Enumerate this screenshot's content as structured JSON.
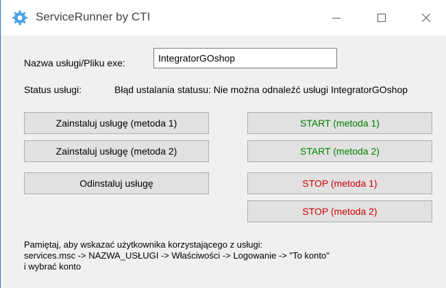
{
  "window": {
    "title": "ServiceRunner by CTI",
    "icon": "gear-icon",
    "controls": [
      "minimize-icon",
      "maximize-icon",
      "close-icon"
    ]
  },
  "service": {
    "name_label": "Nazwa usługi/Pliku exe:",
    "name_value": "IntegratorGOshop",
    "status_label": "Status usługi:",
    "status_value": "Błąd ustalania statusu: Nie można odnaleźć usługi IntegratorGOshop"
  },
  "buttons": {
    "install1": "Zainstaluj usługę (metoda 1)",
    "install2": "Zainstaluj usługę (metoda 2)",
    "uninstall": "Odinstaluj usługę",
    "start1": "START (metoda 1)",
    "start2": "START (metoda 2)",
    "stop1": "STOP (metoda 1)",
    "stop2": "STOP (metoda 2)"
  },
  "note": {
    "line1": "Pamiętaj, aby wskazać użytkownika korzystającego z usługi:",
    "line2": "services.msc -> NAZWA_USŁUGI -> Właściwości -> Logowanie -> \"To konto\"",
    "line3": "i wybrać konto"
  },
  "colors": {
    "start_text": "#008000",
    "stop_text": "#d00000",
    "window_border": "#2b6fd6"
  }
}
